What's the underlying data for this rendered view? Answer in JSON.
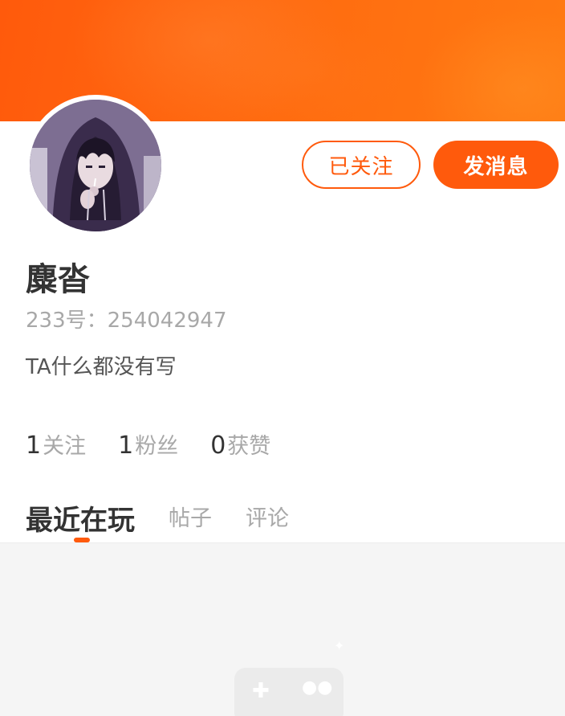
{
  "header": {
    "accent_color": "#ff5a0c"
  },
  "profile": {
    "name": "麋沓",
    "uid_label": "233号：",
    "uid_value": "254042947",
    "bio": "TA什么都没有写"
  },
  "actions": {
    "follow_label": "已关注",
    "message_label": "发消息"
  },
  "stats": [
    {
      "num": "1",
      "label": "关注"
    },
    {
      "num": "1",
      "label": "粉丝"
    },
    {
      "num": "0",
      "label": "获赞"
    }
  ],
  "tabs": [
    {
      "label": "最近在玩",
      "active": true
    },
    {
      "label": "帖子",
      "active": false
    },
    {
      "label": "评论",
      "active": false
    }
  ],
  "icons": {
    "avatar": "hooded-character-avatar",
    "empty_state": "gamepad-icon"
  }
}
